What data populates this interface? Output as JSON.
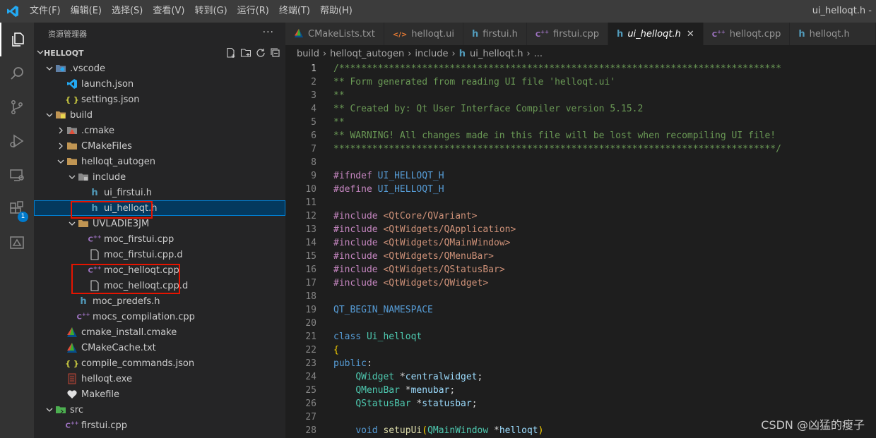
{
  "titlebar": {
    "menu": [
      "文件(F)",
      "编辑(E)",
      "选择(S)",
      "查看(V)",
      "转到(G)",
      "运行(R)",
      "终端(T)",
      "帮助(H)"
    ],
    "window_title": "ui_helloqt.h -"
  },
  "activity": {
    "items": [
      "explorer-icon",
      "search-icon",
      "source-control-icon",
      "run-debug-icon",
      "remote-explorer-icon",
      "extensions-icon",
      "cmake-icon"
    ],
    "extensions_badge": "1"
  },
  "sidebar": {
    "title": "资源管理器",
    "more": "···",
    "section": "HELLOQT",
    "tree": [
      {
        "label": ".vscode",
        "depth": 1,
        "kind": "folder",
        "expanded": true,
        "icon": "vscode-folder"
      },
      {
        "label": "launch.json",
        "depth": 2,
        "kind": "file",
        "icon": "vscode-file"
      },
      {
        "label": "settings.json",
        "depth": 2,
        "kind": "file",
        "icon": "json-file"
      },
      {
        "label": "build",
        "depth": 1,
        "kind": "folder",
        "expanded": true,
        "icon": "build-folder"
      },
      {
        "label": ".cmake",
        "depth": 2,
        "kind": "folder",
        "expanded": false,
        "icon": "cmake-folder"
      },
      {
        "label": "CMakeFiles",
        "depth": 2,
        "kind": "folder",
        "expanded": false,
        "icon": "folder"
      },
      {
        "label": "helloqt_autogen",
        "depth": 2,
        "kind": "folder",
        "expanded": true,
        "icon": "folder"
      },
      {
        "label": "include",
        "depth": 3,
        "kind": "folder",
        "expanded": true,
        "icon": "include-folder"
      },
      {
        "label": "ui_firstui.h",
        "depth": 4,
        "kind": "file",
        "icon": "h-file"
      },
      {
        "label": "ui_helloqt.h",
        "depth": 4,
        "kind": "file",
        "icon": "h-file",
        "selected": true
      },
      {
        "label": "UVLADIE3JM",
        "depth": 3,
        "kind": "folder",
        "expanded": true,
        "icon": "folder"
      },
      {
        "label": "moc_firstui.cpp",
        "depth": 4,
        "kind": "file",
        "icon": "cpp-file"
      },
      {
        "label": "moc_firstui.cpp.d",
        "depth": 4,
        "kind": "file",
        "icon": "plain-file"
      },
      {
        "label": "moc_helloqt.cpp",
        "depth": 4,
        "kind": "file",
        "icon": "cpp-file"
      },
      {
        "label": "moc_helloqt.cpp.d",
        "depth": 4,
        "kind": "file",
        "icon": "plain-file"
      },
      {
        "label": "moc_predefs.h",
        "depth": 3,
        "kind": "file",
        "icon": "h-file"
      },
      {
        "label": "mocs_compilation.cpp",
        "depth": 3,
        "kind": "file",
        "icon": "cpp-file"
      },
      {
        "label": "cmake_install.cmake",
        "depth": 2,
        "kind": "file",
        "icon": "cmake-file"
      },
      {
        "label": "CMakeCache.txt",
        "depth": 2,
        "kind": "file",
        "icon": "cmake-file"
      },
      {
        "label": "compile_commands.json",
        "depth": 2,
        "kind": "file",
        "icon": "json-file"
      },
      {
        "label": "helloqt.exe",
        "depth": 2,
        "kind": "file",
        "icon": "exe-file"
      },
      {
        "label": "Makefile",
        "depth": 2,
        "kind": "file",
        "icon": "makefile-file"
      },
      {
        "label": "src",
        "depth": 1,
        "kind": "folder",
        "expanded": true,
        "icon": "src-folder"
      },
      {
        "label": "firstui.cpp",
        "depth": 2,
        "kind": "file",
        "icon": "cpp-file"
      }
    ]
  },
  "tabs": [
    {
      "label": "CMakeLists.txt",
      "icon": "cmake-file"
    },
    {
      "label": "helloqt.ui",
      "icon": "xml-file"
    },
    {
      "label": "firstui.h",
      "icon": "h-file"
    },
    {
      "label": "firstui.cpp",
      "icon": "cpp-file"
    },
    {
      "label": "ui_helloqt.h",
      "icon": "h-file",
      "active": true
    },
    {
      "label": "helloqt.cpp",
      "icon": "cpp-file"
    },
    {
      "label": "helloqt.h",
      "icon": "h-file"
    }
  ],
  "breadcrumbs": [
    "build",
    "helloqt_autogen",
    "include",
    "ui_helloqt.h",
    "..."
  ],
  "code": {
    "current_line": 1,
    "lines": [
      {
        "n": "1",
        "tokens": [
          [
            "comment",
            "/********************************************************************************"
          ]
        ]
      },
      {
        "n": "2",
        "tokens": [
          [
            "comment",
            "** Form generated from reading UI file 'helloqt.ui'"
          ]
        ]
      },
      {
        "n": "3",
        "tokens": [
          [
            "comment",
            "**"
          ]
        ]
      },
      {
        "n": "4",
        "tokens": [
          [
            "comment",
            "** Created by: Qt User Interface Compiler version 5.15.2"
          ]
        ]
      },
      {
        "n": "5",
        "tokens": [
          [
            "comment",
            "**"
          ]
        ]
      },
      {
        "n": "6",
        "tokens": [
          [
            "comment",
            "** WARNING! All changes made in this file will be lost when recompiling UI file!"
          ]
        ]
      },
      {
        "n": "7",
        "tokens": [
          [
            "comment",
            "********************************************************************************/"
          ]
        ]
      },
      {
        "n": "8",
        "tokens": []
      },
      {
        "n": "9",
        "tokens": [
          [
            "pre",
            "#ifndef "
          ],
          [
            "macro",
            "UI_HELLOQT_H"
          ]
        ]
      },
      {
        "n": "10",
        "tokens": [
          [
            "pre",
            "#define "
          ],
          [
            "macro",
            "UI_HELLOQT_H"
          ]
        ]
      },
      {
        "n": "11",
        "tokens": []
      },
      {
        "n": "12",
        "tokens": [
          [
            "pre",
            "#include "
          ],
          [
            "incpath",
            "<QtCore/QVariant>"
          ]
        ]
      },
      {
        "n": "13",
        "tokens": [
          [
            "pre",
            "#include "
          ],
          [
            "incpath",
            "<QtWidgets/QApplication>"
          ]
        ]
      },
      {
        "n": "14",
        "tokens": [
          [
            "pre",
            "#include "
          ],
          [
            "incpath",
            "<QtWidgets/QMainWindow>"
          ]
        ]
      },
      {
        "n": "15",
        "tokens": [
          [
            "pre",
            "#include "
          ],
          [
            "incpath",
            "<QtWidgets/QMenuBar>"
          ]
        ]
      },
      {
        "n": "16",
        "tokens": [
          [
            "pre",
            "#include "
          ],
          [
            "incpath",
            "<QtWidgets/QStatusBar>"
          ]
        ]
      },
      {
        "n": "17",
        "tokens": [
          [
            "pre",
            "#include "
          ],
          [
            "incpath",
            "<QtWidgets/QWidget>"
          ]
        ]
      },
      {
        "n": "18",
        "tokens": []
      },
      {
        "n": "19",
        "tokens": [
          [
            "macro",
            "QT_BEGIN_NAMESPACE"
          ]
        ]
      },
      {
        "n": "20",
        "tokens": []
      },
      {
        "n": "21",
        "tokens": [
          [
            "keyword",
            "class "
          ],
          [
            "type",
            "Ui_helloqt"
          ]
        ]
      },
      {
        "n": "22",
        "tokens": [
          [
            "punct",
            "{"
          ]
        ]
      },
      {
        "n": "23",
        "tokens": [
          [
            "keyword",
            "public"
          ],
          [
            "plain",
            ":"
          ]
        ]
      },
      {
        "n": "24",
        "tokens": [
          [
            "plain",
            "    "
          ],
          [
            "type",
            "QWidget"
          ],
          [
            "plain",
            " *"
          ],
          [
            "ident",
            "centralwidget"
          ],
          [
            "plain",
            ";"
          ]
        ]
      },
      {
        "n": "25",
        "tokens": [
          [
            "plain",
            "    "
          ],
          [
            "type",
            "QMenuBar"
          ],
          [
            "plain",
            " *"
          ],
          [
            "ident",
            "menubar"
          ],
          [
            "plain",
            ";"
          ]
        ]
      },
      {
        "n": "26",
        "tokens": [
          [
            "plain",
            "    "
          ],
          [
            "type",
            "QStatusBar"
          ],
          [
            "plain",
            " *"
          ],
          [
            "ident",
            "statusbar"
          ],
          [
            "plain",
            ";"
          ]
        ]
      },
      {
        "n": "27",
        "tokens": []
      },
      {
        "n": "28",
        "tokens": [
          [
            "plain",
            "    "
          ],
          [
            "keyword",
            "void "
          ],
          [
            "func",
            "setupUi"
          ],
          [
            "punct",
            "("
          ],
          [
            "type",
            "QMainWindow"
          ],
          [
            "plain",
            " *"
          ],
          [
            "ident",
            "helloqt"
          ],
          [
            "punct",
            ")"
          ]
        ]
      }
    ]
  },
  "watermark": "CSDN @凶猛的瘦子",
  "colors": {
    "accent": "#007acc",
    "highlight_box": "#e51400",
    "selection": "#04395e"
  }
}
